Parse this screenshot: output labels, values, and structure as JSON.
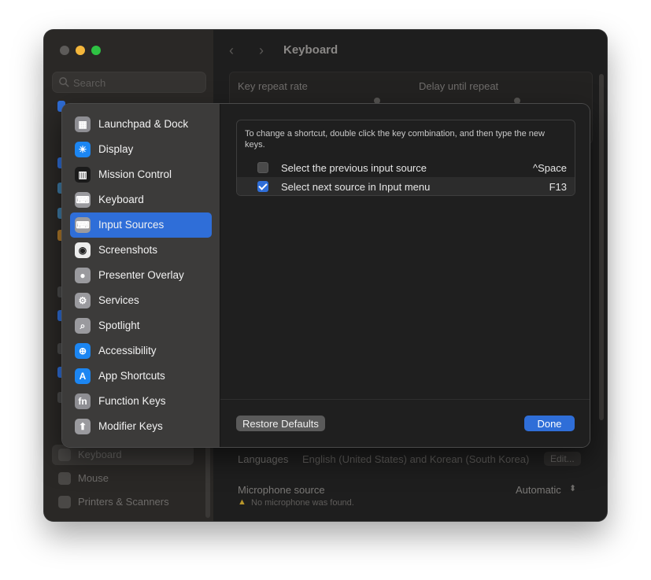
{
  "window": {
    "title": "Keyboard",
    "search_placeholder": "Search"
  },
  "background_sidebar": [
    {
      "label": "Keyboard",
      "icon": "keyboard-icon",
      "selected": true
    },
    {
      "label": "Mouse",
      "icon": "mouse-icon",
      "selected": false
    },
    {
      "label": "Printers & Scanners",
      "icon": "printer-icon",
      "selected": false
    }
  ],
  "background_main": {
    "key_repeat_label": "Key repeat rate",
    "delay_label": "Delay until repeat",
    "languages_label": "Languages",
    "languages_value": "English (United States) and Korean (South Korea)",
    "edit_label": "Edit...",
    "mic_label": "Microphone source",
    "mic_value": "Automatic",
    "mic_warning": "No microphone was found."
  },
  "sheet": {
    "categories": [
      {
        "label": "Launchpad & Dock",
        "icon": "launchpad-icon",
        "color": "#8e8e93",
        "glyph": "▦"
      },
      {
        "label": "Display",
        "icon": "sun-icon",
        "color": "#1c86f2",
        "glyph": "☀"
      },
      {
        "label": "Mission Control",
        "icon": "mission-control-icon",
        "color": "#1b1b1b",
        "glyph": "▥"
      },
      {
        "label": "Keyboard",
        "icon": "keyboard-icon",
        "color": "#9a9a9e",
        "glyph": "⌨"
      },
      {
        "label": "Input Sources",
        "icon": "input-sources-icon",
        "color": "#9a9a9e",
        "glyph": "⌨"
      },
      {
        "label": "Screenshots",
        "icon": "screenshot-icon",
        "color": "#ececec",
        "glyph": "◉"
      },
      {
        "label": "Presenter Overlay",
        "icon": "presenter-icon",
        "color": "#9a9a9e",
        "glyph": "●"
      },
      {
        "label": "Services",
        "icon": "gear-icon",
        "color": "#9a9a9e",
        "glyph": "⚙"
      },
      {
        "label": "Spotlight",
        "icon": "search-icon",
        "color": "#9a9a9e",
        "glyph": "⌕"
      },
      {
        "label": "Accessibility",
        "icon": "accessibility-icon",
        "color": "#1c86f2",
        "glyph": "⊕"
      },
      {
        "label": "App Shortcuts",
        "icon": "app-store-icon",
        "color": "#1c86f2",
        "glyph": "A"
      },
      {
        "label": "Function Keys",
        "icon": "fn-icon",
        "color": "#8e8e93",
        "glyph": "fn"
      },
      {
        "label": "Modifier Keys",
        "icon": "modifier-arrow-icon",
        "color": "#9a9a9e",
        "glyph": "⬆"
      }
    ],
    "selected_index": 4,
    "hint": "To change a shortcut, double click the key combination, and then type the new keys.",
    "shortcuts": [
      {
        "label": "Select the previous input source",
        "key": "^Space",
        "checked": false
      },
      {
        "label": "Select next source in Input menu",
        "key": "F13",
        "checked": true
      }
    ],
    "restore_label": "Restore Defaults",
    "done_label": "Done"
  }
}
